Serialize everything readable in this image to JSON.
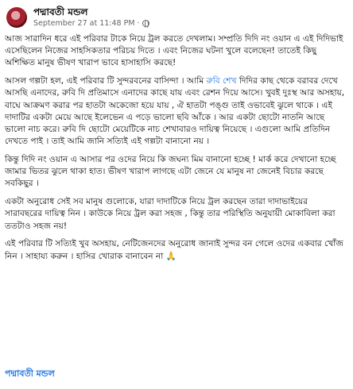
{
  "post": {
    "author": "পদ্মাবতী মন্ডল",
    "timestamp": "September 27 at 11:48 PM",
    "dot": "·",
    "paragraphs": [
      {
        "text": "আজ সারাদিন ধরে এই পরিবার টাকে নিয়ে ট্রল করতে দেখলাম। সম্প্রতি দিদি নং ওয়ান এ এই দিদিভাই এসেছিলেন নিজের সাহসিকতার পরিচয় দিতে । এবং নিজের ঘটনা খুলে বলেছেন! তাতেই কিছু অশিক্ষিত মানুষ ভীষণ খারাপ ভাবে হাসাহাসি করছে!"
      },
      {
        "before": "আসল গল্পটা হল, এই পরিবার টি সুন্দরবনের বাসিন্দা । আমি ",
        "tag": "রুবি শেখ",
        "after": " দিদির কাছ থেকে বরাবর দেখে আসছি এনাদের, রুবি দি প্রতিমাসে এনাদের কাছে যায় এবং রেশন দিয়ে আসে। খুবই দুঃস্থ আর অসহায়, বাঘে আক্রমণ করার পর হাতটা অকেজো হয়ে যায় , ঐ হাতটা পঙ্গু তাই ওভাবেই ঝুলে থাকে । এই দাদাটির একটা মেয়ে আছে ইলেভেন এ পড়ে ভালো ছবি আঁকে । আর একটা ছোটো নাতনি আছে ভালো নাচ করে। রুবি দি ছোটো মেয়েটিকে নাচ শেখাবারও দায়িত্ব নিয়েছে । এগুলো আমি প্রতিদিন দেখতে পাই । তাই আমি জানি সত্যিই এই গল্পটা বানানো নয় ।"
      },
      {
        "text": "কিন্তু দিদি নং ওয়ান এ আসার পর ওদের নিয়ে কি জঘন্য মিম বানানো হচ্ছে ! মার্ক করে দেখানো হচ্ছে জামার ভিতর ঝুলে থাকা হাত। ভীষণ খারাপ লাগছে এটা জেনে যে মানুষ না জেনেই বিচার করছে সবকিছুর ।"
      },
      {
        "text": "একটা অনুরোধ সেই সব মানুষ গুলোকে, যারা দাদাটিকে নিয়ে ট্রল করছেন তারা দাদাভাইয়ের সারাবছরের দায়িত্ব নিন । কাউকে নিয়ে ট্রল করা সহজ , কিন্তু তার পরিস্থিতি অনুযায়ী মোকাবিলা করা ততটাও সহজ নয়!"
      },
      {
        "text": "এই পরিবার টি সত্যিই খুব অসহায়, নেটিজেনদের অনুরোধ জানাই সুন্দর বন গেলে ওদের একবার খোঁজ নিন । সাহায্য করুন । হাসির খোরাক বানাবেন না 🙏"
      }
    ],
    "signature": "পদ্মাবতী মন্ডল"
  },
  "icons": {
    "avatar": "profile-photo",
    "privacy": "globe-icon"
  }
}
